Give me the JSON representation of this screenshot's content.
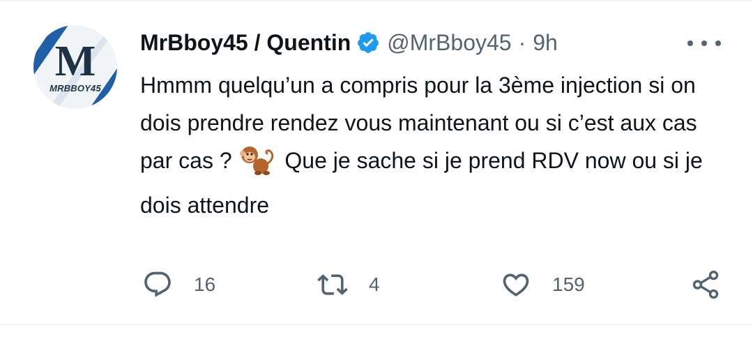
{
  "tweet": {
    "author": {
      "display_name": "MrBboy45 / Quentin",
      "handle": "@MrBboy45",
      "verified": true,
      "avatar": {
        "letter": "M",
        "text": "MRBBOY45"
      }
    },
    "separator": "·",
    "timestamp": "9h",
    "text_before_emoji": "Hmmm quelqu’un a compris pour la 3ème injection si on dois prendre rendez vous maintenant ou si c’est aux cas par cas ?",
    "emoji": "monkey",
    "text_after_emoji": "Que je sache si je prend RDV now ou si je dois attendre",
    "metrics": {
      "replies": "16",
      "retweets": "4",
      "likes": "159"
    }
  },
  "icons": {
    "verified": "verified-badge-icon",
    "more": "more-options-icon",
    "reply": "reply-icon",
    "retweet": "retweet-icon",
    "like": "heart-icon",
    "share": "share-icon"
  },
  "colors": {
    "text": "#0f1419",
    "secondary": "#536471",
    "verified": "#1d9bf0",
    "divider": "#eff3f4",
    "avatar_stripe": "#1f5fa8"
  }
}
